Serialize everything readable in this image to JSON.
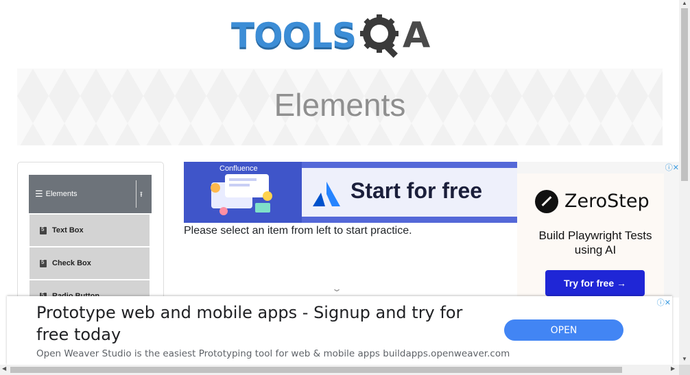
{
  "header": {
    "logo_tools": "TOOLS",
    "logo_a": "A",
    "brand_blue": "#3c8dd6",
    "brand_dark": "#4a4a4a"
  },
  "banner": {
    "title": "Elements"
  },
  "sidebar": {
    "group_label": "Elements",
    "group_icon": "hamburger-icon",
    "collapse_icon": "collapse-up-icon",
    "items": [
      {
        "label": "Text Box",
        "icon": "html5-icon"
      },
      {
        "label": "Check Box",
        "icon": "html5-icon"
      },
      {
        "label": "Radio Button",
        "icon": "html5-icon"
      }
    ]
  },
  "main": {
    "instruction": "Please select an item from left to start practice.",
    "scroll_hint_icon": "chevron-down-icon"
  },
  "ads": {
    "confluence": {
      "brand": "Confluence",
      "cta": "Start for free",
      "accent": "#5468d8"
    },
    "zerostep": {
      "name": "ZeroStep",
      "tagline": "Build Playwright Tests using AI",
      "button": "Try for free →",
      "button_color": "#1f26d6"
    },
    "bottom": {
      "headline": "Prototype web and mobile apps - Signup and try for free today",
      "subtext": "Open Weaver Studio is the easiest Prototyping tool for web & mobile apps buildapps.openweaver.com",
      "button": "OPEN",
      "button_color": "#4285f4"
    }
  }
}
